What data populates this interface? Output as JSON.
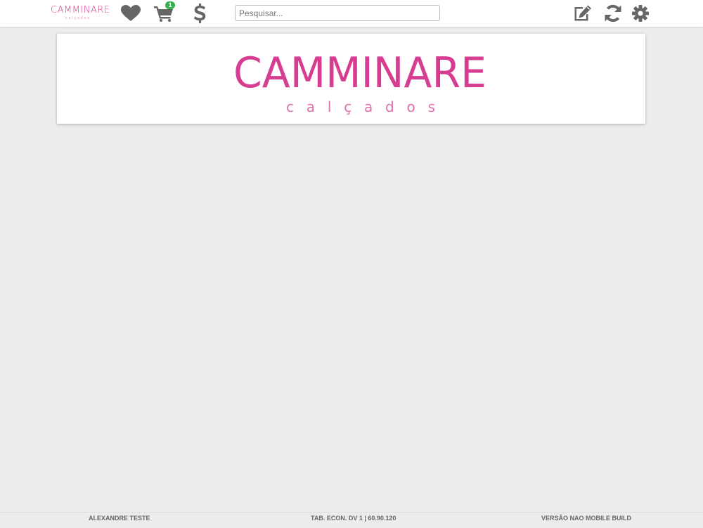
{
  "brand": {
    "logo_word": "CAMMINARE",
    "logo_sub": "calçados",
    "color": "#d63c8f"
  },
  "header": {
    "favorites_icon": "heart-icon",
    "cart_icon": "cart-icon",
    "cart_count": "1",
    "price_icon": "dollar-icon",
    "search_placeholder": "Pesquisar...",
    "edit_icon": "edit-icon",
    "sync_icon": "refresh-icon",
    "settings_icon": "gear-icon",
    "icon_color": "#666666",
    "badge_color": "#31b24a"
  },
  "footer": {
    "user": "ALEXANDRE TESTE",
    "price_table": "TAB. ECON. DV 1 | 60.90.120",
    "version": "VERSÃO NAO MOBILE BUILD"
  }
}
